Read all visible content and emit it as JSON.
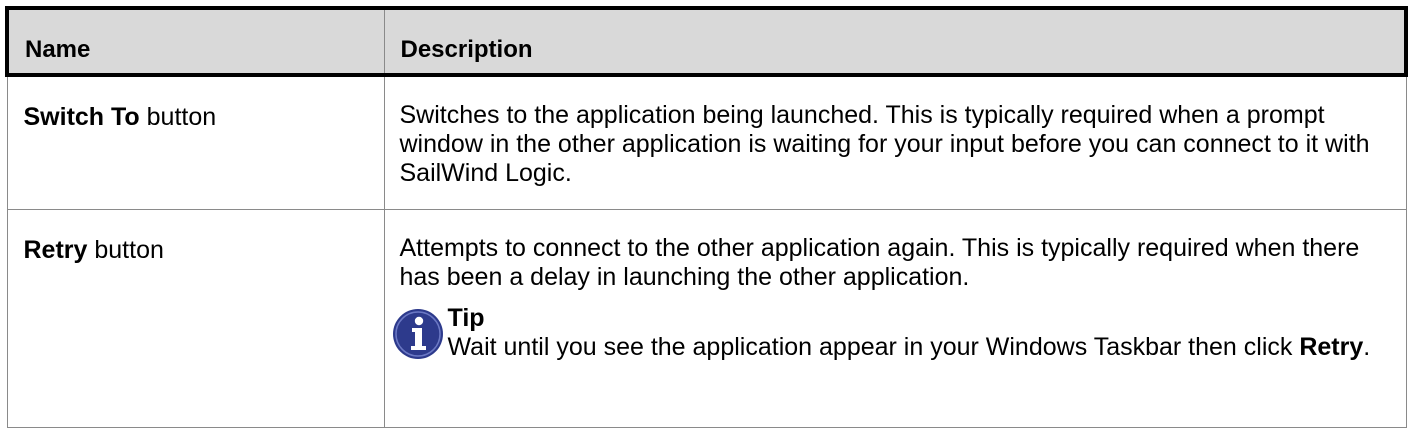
{
  "table": {
    "headers": {
      "name": "Name",
      "description": "Description"
    },
    "rows": [
      {
        "name_bold": "Switch To",
        "name_rest": " button",
        "description": "Switches to the application being launched. This is typically required when a prompt window in the other application is waiting for your input before you can connect to it with SailWind Logic."
      },
      {
        "name_bold": "Retry",
        "name_rest": " button",
        "description": "Attempts to connect to the other application again. This is typically required when there has been a delay in launching the other application.",
        "tip": {
          "icon": "info-icon",
          "title": "Tip",
          "body_before": "Wait until you see the application appear in your Windows Taskbar then click ",
          "body_bold": "Retry",
          "body_after": "."
        }
      }
    ]
  },
  "colors": {
    "header_bg": "#d9d9d9",
    "icon_blue": "#2d3a8c"
  }
}
